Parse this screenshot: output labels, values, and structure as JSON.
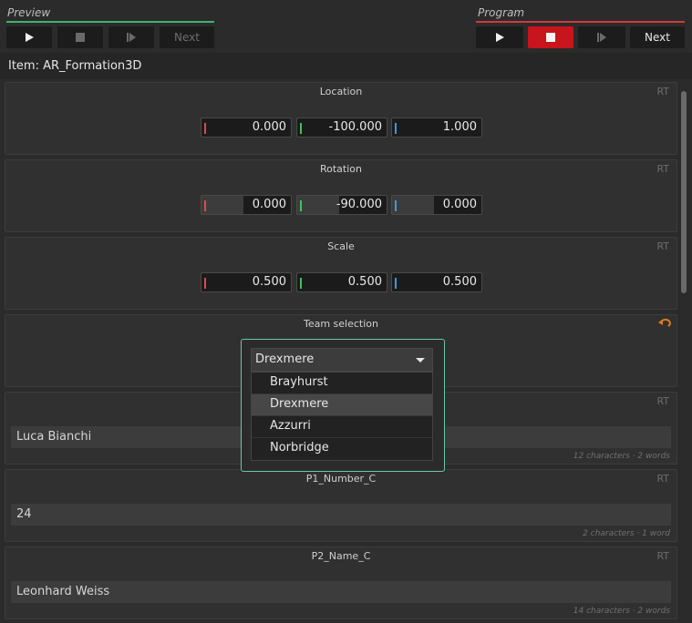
{
  "preview": {
    "title": "Preview",
    "line_color": "#3cb371",
    "next_label": "Next"
  },
  "program": {
    "title": "Program",
    "line_color": "#d23a3a",
    "next_label": "Next"
  },
  "item": {
    "label": "Item: AR_Formation3D"
  },
  "rt_label": "RT",
  "location": {
    "title": "Location",
    "x": "0.000",
    "y": "-100.000",
    "z": "1.000"
  },
  "rotation": {
    "title": "Rotation",
    "x": "0.000",
    "y": "-90.000",
    "z": "0.000"
  },
  "scale": {
    "title": "Scale",
    "x": "0.500",
    "y": "0.500",
    "z": "0.500"
  },
  "team": {
    "title": "Team selection",
    "selected": "Drexmere",
    "options": [
      "Brayhurst",
      "Drexmere",
      "Azzurri",
      "Norbridge"
    ]
  },
  "p1_name": {
    "value": "Luca Bianchi",
    "meta": "12 characters · 2 words"
  },
  "p1_number": {
    "title": "P1_Number_C",
    "value": "24",
    "meta": "2 characters · 1 word"
  },
  "p2_name": {
    "title": "P2_Name_C",
    "value": "Leonhard Weiss",
    "meta": "14 characters · 2 words"
  },
  "colors": {
    "axis_x": "#e04848",
    "axis_y": "#3cc45a",
    "axis_z": "#3a9be0",
    "accent": "#6fc7a4",
    "undo": "#e07a1e"
  }
}
